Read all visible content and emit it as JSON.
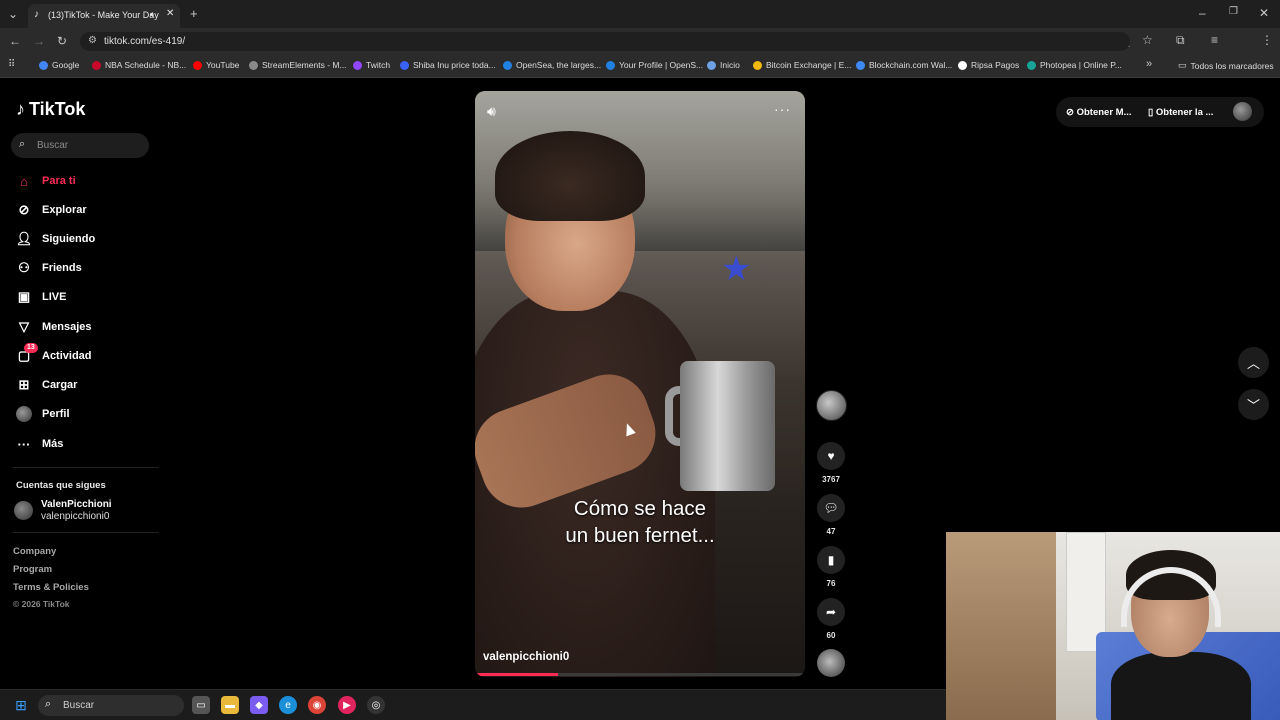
{
  "browser": {
    "tab_title": "(13)TikTok - Make Your Day",
    "url": "tiktok.com/es-419/",
    "bookmarks": [
      {
        "label": "Google",
        "color": "#4285f4"
      },
      {
        "label": "NBA Schedule - NB...",
        "color": "#c9082a"
      },
      {
        "label": "YouTube",
        "color": "#ff0000"
      },
      {
        "label": "StreamElements - M...",
        "color": "#8a8a8a"
      },
      {
        "label": "Twitch",
        "color": "#9146ff"
      },
      {
        "label": "Shiba Inu price toda...",
        "color": "#3861fb"
      },
      {
        "label": "OpenSea, the larges...",
        "color": "#2081e2"
      },
      {
        "label": "Your Profile | OpenS...",
        "color": "#2081e2"
      },
      {
        "label": "Inicio",
        "color": "#6ea0e6"
      },
      {
        "label": "Bitcoin Exchange | E...",
        "color": "#f0b90b"
      },
      {
        "label": "Blockchain.com Wal...",
        "color": "#3d89f5"
      },
      {
        "label": "Ripsa Pagos",
        "color": "#ffffff"
      },
      {
        "label": "Photopea | Online P...",
        "color": "#18a497"
      }
    ],
    "all_bookmarks": "Todos los marcadores"
  },
  "sidebar": {
    "logo": "TikTok",
    "search_placeholder": "Buscar",
    "items": [
      {
        "label": "Para ti",
        "icon": "home-icon"
      },
      {
        "label": "Explorar",
        "icon": "compass-icon"
      },
      {
        "label": "Siguiendo",
        "icon": "following-icon"
      },
      {
        "label": "Friends",
        "icon": "friends-icon"
      },
      {
        "label": "LIVE",
        "icon": "live-icon"
      },
      {
        "label": "Mensajes",
        "icon": "messages-icon"
      },
      {
        "label": "Actividad",
        "icon": "activity-icon",
        "badge": "13"
      },
      {
        "label": "Cargar",
        "icon": "upload-icon"
      },
      {
        "label": "Perfil",
        "icon": "profile-icon"
      },
      {
        "label": "Más",
        "icon": "more-icon"
      }
    ],
    "following_title": "Cuentas que sigues",
    "following": [
      {
        "name": "ValenPicchioni",
        "handle": "valenpicchioni0"
      }
    ],
    "footer": [
      "Company",
      "Program",
      "Terms & Policies",
      "© 2026 TikTok"
    ]
  },
  "header": {
    "get_coins": "Obtener M...",
    "get_app": "Obtener la ..."
  },
  "video": {
    "caption_line1": "Cómo se hace",
    "caption_line2": "un buen fernet...",
    "username": "valenpicchioni0",
    "progress": 0.25,
    "likes": "3767",
    "comments": "47",
    "saves": "76",
    "shares": "60"
  },
  "taskbar": {
    "search_placeholder": "Buscar"
  },
  "colors": {
    "accent": "#fe2c55",
    "background": "#000000"
  }
}
